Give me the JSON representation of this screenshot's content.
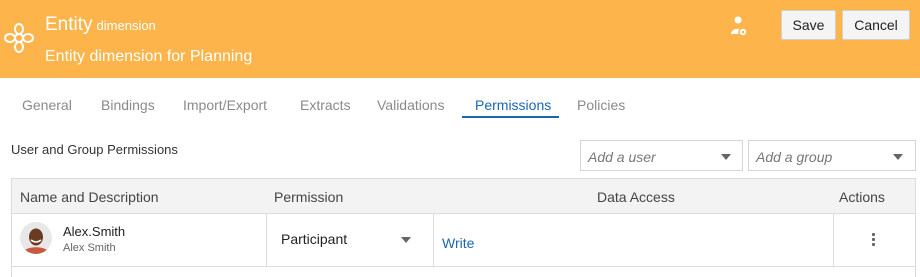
{
  "header": {
    "title": "Entity",
    "title_suffix": "dimension",
    "subtitle": "Entity dimension for Planning",
    "icon": "flower-icon",
    "user_icon": "user-settings-icon",
    "save_label": "Save",
    "cancel_label": "Cancel",
    "color": "#fdb44b"
  },
  "tabs": [
    {
      "label": "General"
    },
    {
      "label": "Bindings"
    },
    {
      "label": "Import/Export"
    },
    {
      "label": "Extracts"
    },
    {
      "label": "Validations"
    },
    {
      "label": "Permissions",
      "active": true
    },
    {
      "label": "Policies"
    }
  ],
  "permissions": {
    "section_title": "User and Group Permissions",
    "add_user_placeholder": "Add a user",
    "add_group_placeholder": "Add a group",
    "columns": [
      "Name and Description",
      "Permission",
      "Data Access",
      "Actions"
    ],
    "rows": [
      {
        "name": "Alex.Smith",
        "description": "Alex Smith",
        "permission": "Participant",
        "data_access": "Write"
      }
    ]
  },
  "accent_color": "#1a66b5"
}
